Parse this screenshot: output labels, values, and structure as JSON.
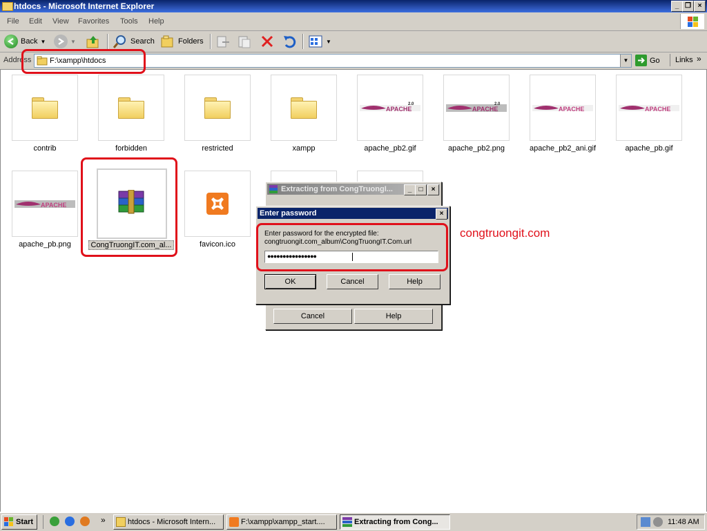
{
  "window": {
    "title": "htdocs - Microsoft Internet Explorer"
  },
  "menu": [
    "File",
    "Edit",
    "View",
    "Favorites",
    "Tools",
    "Help"
  ],
  "toolbar": {
    "back": "Back",
    "search": "Search",
    "folders": "Folders"
  },
  "address": {
    "label": "Address",
    "value": "F:\\xampp\\htdocs",
    "go": "Go",
    "links": "Links"
  },
  "files": [
    {
      "name": "contrib",
      "icon": "folder-icon"
    },
    {
      "name": "forbidden",
      "icon": "folder-icon"
    },
    {
      "name": "restricted",
      "icon": "folder-icon"
    },
    {
      "name": "xampp",
      "icon": "folder-icon"
    },
    {
      "name": "apache_pb2.gif",
      "icon": "apache-logo-icon"
    },
    {
      "name": "apache_pb2.png",
      "icon": "apache-logo-icon"
    },
    {
      "name": "apache_pb2_ani.gif",
      "icon": "apache-logo-icon"
    },
    {
      "name": "apache_pb.gif",
      "icon": "apache-logo-icon"
    },
    {
      "name": "apache_pb.png",
      "icon": "apache-logo-icon"
    },
    {
      "name": "CongTruongIT.com_al...",
      "icon": "winrar-archive-icon"
    },
    {
      "name": "favicon.ico",
      "icon": "xampp-icon"
    }
  ],
  "extract_dialog": {
    "title": "Extracting from CongTruongI...",
    "cancel": "Cancel",
    "help": "Help"
  },
  "password_dialog": {
    "title": "Enter password",
    "prompt": "Enter password for the encrypted file:",
    "path": "congtruongit.com_album\\CongTruongIT.Com.url",
    "password": "●●●●●●●●●●●●●●●●",
    "ok": "OK",
    "cancel": "Cancel",
    "help": "Help"
  },
  "watermark": "congtruongit.com",
  "taskbar": {
    "start": "Start",
    "tasks": [
      "htdocs - Microsoft Intern...",
      "F:\\xampp\\xampp_start....",
      "Extracting from Cong..."
    ],
    "clock": "11:48 AM"
  },
  "colors": {
    "highlight": "#e0101a",
    "titlebar": "#0a246a",
    "face": "#d4d0c8"
  }
}
